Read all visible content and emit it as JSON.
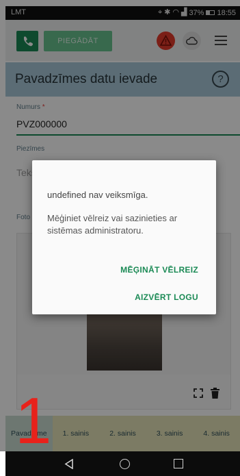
{
  "status_bar": {
    "carrier": "LMT",
    "battery": "37%",
    "time": "18:55"
  },
  "toolbar": {
    "deliver_label": "PIEGĀDĀT"
  },
  "page": {
    "title": "Pavadzīmes datu ievade",
    "help_glyph": "?"
  },
  "form": {
    "number_label": "Numurs",
    "required_mark": "*",
    "number_value": "PVZ000000",
    "notes_label": "Piezīmes",
    "notes_placeholder": "Teksts",
    "photo_label": "Foto"
  },
  "dialog": {
    "title": "undefined nav veiksmīga.",
    "message": "Mēģiniet vēlreiz vai sazinieties ar sistēmas administratoru.",
    "retry_label": "MĒĢINĀT VĒLREIZ",
    "close_label": "AIZVĒRT LOGU"
  },
  "tabs": [
    "Pavadzīme",
    "1. sainis",
    "2. sainis",
    "3. sainis",
    "4. sainis"
  ],
  "annotation": {
    "number": "1"
  },
  "colors": {
    "accent_green": "#1b8a55",
    "title_bar": "#a8c8d8",
    "tab_bar": "#e6e3ba",
    "alert_red": "#e33a2b"
  }
}
